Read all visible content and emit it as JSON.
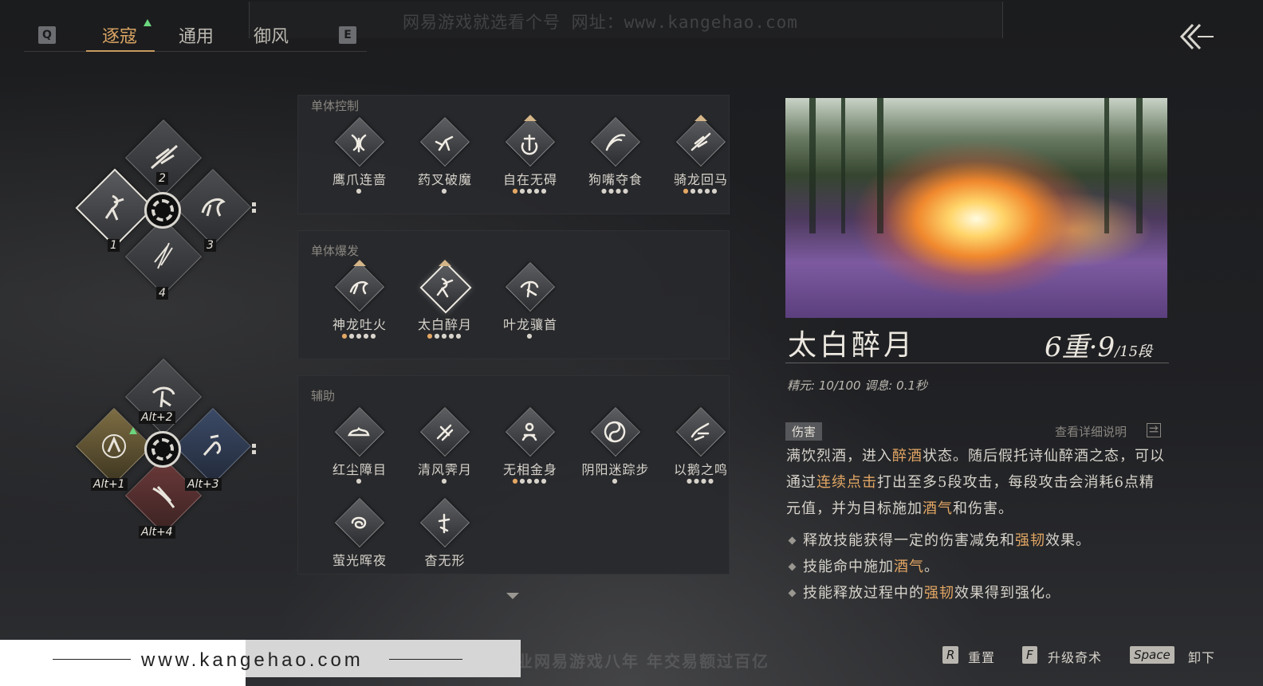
{
  "watermark": {
    "top": "网易游戏就选看个号   网址：www.kangehao.com",
    "bottom": "看个号专业网易游戏八年   年交易额过百亿",
    "site": "www.kangehao.com"
  },
  "tabs": {
    "prev_key": "Q",
    "next_key": "E",
    "items": [
      {
        "label": "逐寇",
        "active": true
      },
      {
        "label": "通用",
        "active": false
      },
      {
        "label": "御风",
        "active": false
      }
    ]
  },
  "loadout": {
    "primary_slots": [
      "1",
      "2",
      "3",
      "4"
    ],
    "alt_slots": [
      "Alt+1",
      "Alt+2",
      "Alt+3",
      "Alt+4"
    ]
  },
  "skill_groups": [
    {
      "title": "单体控制",
      "skills": [
        {
          "name": "鹰爪连啬",
          "dots": 1,
          "lit": 0,
          "marker": false,
          "icon": "claw-icon"
        },
        {
          "name": "药叉破魔",
          "dots": 1,
          "lit": 0,
          "marker": false,
          "icon": "kick-icon"
        },
        {
          "name": "自在无碍",
          "dots": 5,
          "lit": 1,
          "marker": true,
          "icon": "spin-icon"
        },
        {
          "name": "狗嘴夺食",
          "dots": 4,
          "lit": 0,
          "marker": false,
          "icon": "slash-icon"
        },
        {
          "name": "骑龙回马",
          "dots": 5,
          "lit": 1,
          "marker": true,
          "icon": "spear-icon"
        }
      ]
    },
    {
      "title": "单体爆发",
      "skills": [
        {
          "name": "神龙吐火",
          "dots": 5,
          "lit": 1,
          "marker": true,
          "icon": "dragon-icon"
        },
        {
          "name": "太白醉月",
          "dots": 5,
          "lit": 1,
          "marker": true,
          "icon": "drunk-icon",
          "selected": true
        },
        {
          "name": "叶龙骧首",
          "dots": 1,
          "lit": 0,
          "marker": false,
          "icon": "leap-icon"
        }
      ]
    },
    {
      "title": "辅助",
      "skills": [
        {
          "name": "红尘障目",
          "dots": 1,
          "lit": 0,
          "marker": false,
          "icon": "cloud-icon"
        },
        {
          "name": "清风霁月",
          "dots": 1,
          "lit": 0,
          "marker": false,
          "icon": "wind-icon"
        },
        {
          "name": "无相金身",
          "dots": 5,
          "lit": 1,
          "marker": false,
          "icon": "meditate-icon"
        },
        {
          "name": "阴阳迷踪步",
          "dots": 1,
          "lit": 0,
          "marker": false,
          "icon": "yinyang-icon"
        },
        {
          "name": "以鹅之鸣",
          "dots": 4,
          "lit": 0,
          "marker": false,
          "icon": "goose-icon"
        },
        {
          "name": "萤光晖夜",
          "dots": 0,
          "lit": 0,
          "marker": false,
          "icon": "swirl-icon"
        },
        {
          "name": "杳无形",
          "dots": 0,
          "lit": 0,
          "marker": false,
          "icon": "shadow-icon"
        }
      ]
    }
  ],
  "detail": {
    "name": "太白醉月",
    "level_main": "6重·9",
    "level_sub": "/15段",
    "stats": "精元: 10/100   调息: 0.1秒",
    "tag": "伤害",
    "detail_link": "查看详细说明",
    "desc_parts": [
      {
        "t": "满饮烈酒，进入",
        "h": false
      },
      {
        "t": "醉酒",
        "h": true
      },
      {
        "t": "状态。随后假托诗仙醉酒之态，可以通过",
        "h": false
      },
      {
        "t": "连续点击",
        "h": true
      },
      {
        "t": "打出至多5段攻击，每段攻击会消耗6点精元值，并为目标施加",
        "h": false
      },
      {
        "t": "酒气",
        "h": true
      },
      {
        "t": "和伤害。",
        "h": false
      }
    ],
    "bullets": [
      [
        {
          "t": "释放技能获得一定的伤害减免和",
          "h": false
        },
        {
          "t": "强韧",
          "h": true
        },
        {
          "t": "效果。",
          "h": false
        }
      ],
      [
        {
          "t": "技能命中施加",
          "h": false
        },
        {
          "t": "酒气",
          "h": true
        },
        {
          "t": "。",
          "h": false
        }
      ],
      [
        {
          "t": "技能释放过程中的",
          "h": false
        },
        {
          "t": "强韧",
          "h": true
        },
        {
          "t": "效果得到强化。",
          "h": false
        }
      ]
    ]
  },
  "hints": [
    {
      "key": "R",
      "label": "重置"
    },
    {
      "key": "F",
      "label": "升级奇术"
    },
    {
      "key": "Space",
      "label": "卸下"
    }
  ],
  "colors": {
    "accent": "#e3a764",
    "tab_active": "#d9a463",
    "new_arrow": "#6bd67e"
  }
}
